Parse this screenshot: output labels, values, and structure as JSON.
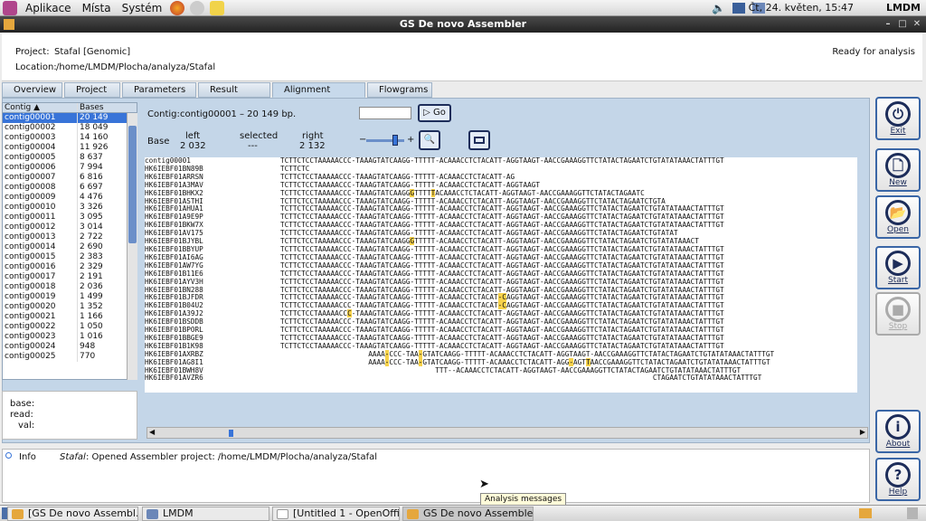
{
  "top_panel": {
    "menus": [
      "Aplikace",
      "Místa",
      "Systém"
    ],
    "clock": "Čt, 24. květen, 15:47",
    "user": "LMDM"
  },
  "window": {
    "title": "GS De novo Assembler"
  },
  "header": {
    "project_label": "Project:",
    "project_value": "Stafal  [Genomic]",
    "location_label": "Location:",
    "location_value": "/home/LMDM/Plocha/analyza/Stafal",
    "status": "Ready for analysis"
  },
  "tabs": [
    "Overview",
    "Project",
    "Parameters",
    "Result files",
    "Alignment results",
    "Flowgrams"
  ],
  "contig_table": {
    "headers": [
      "Contig ▲",
      "Bases"
    ],
    "rows": [
      [
        "contig00001",
        "20 149"
      ],
      [
        "contig00002",
        "18 049"
      ],
      [
        "contig00003",
        "14 160"
      ],
      [
        "contig00004",
        "11 926"
      ],
      [
        "contig00005",
        "8 637"
      ],
      [
        "contig00006",
        "7 994"
      ],
      [
        "contig00007",
        "6 816"
      ],
      [
        "contig00008",
        "6 697"
      ],
      [
        "contig00009",
        "4 476"
      ],
      [
        "contig00010",
        "3 326"
      ],
      [
        "contig00011",
        "3 095"
      ],
      [
        "contig00012",
        "3 014"
      ],
      [
        "contig00013",
        "2 722"
      ],
      [
        "contig00014",
        "2 690"
      ],
      [
        "contig00015",
        "2 383"
      ],
      [
        "contig00016",
        "2 329"
      ],
      [
        "contig00017",
        "2 191"
      ],
      [
        "contig00018",
        "2 036"
      ],
      [
        "contig00019",
        "1 499"
      ],
      [
        "contig00020",
        "1 352"
      ],
      [
        "contig00021",
        "1 166"
      ],
      [
        "contig00022",
        "1 050"
      ],
      [
        "contig00023",
        "1 016"
      ],
      [
        "contig00024",
        "948"
      ],
      [
        "contig00025",
        "770"
      ]
    ]
  },
  "info_panel": {
    "base": "base:",
    "read": "read:",
    "val": "val:"
  },
  "contig_info": {
    "label": "Contig:",
    "value": "contig00001 – 20 149 bp."
  },
  "go_button": "Go",
  "base_info": {
    "label": "Base",
    "left_label": "left",
    "left_value": "2 032",
    "selected_label": "selected",
    "selected_value": "---",
    "right_label": "right",
    "right_value": "2 132"
  },
  "zoom": {
    "minus": "−",
    "plus": "+",
    "level": 0.8
  },
  "alignment": [
    {
      "name": "contig00001",
      "seq": "TCTTCTCCTAAAAACCC-TAAAGTATCAAGG-TTTTT-ACAAACCTCTACATT-AGGTAAGT-AACCGAAAGGTTCTATACTAGAATCTGTATATAAACTATTTGT"
    },
    {
      "name": "HK6IEBF01BN89B",
      "seq": "TCTTCTC"
    },
    {
      "name": "HK6IEBF01ARRSN",
      "seq": "TCTTCTCCTAAAAACCC-TAAAGTATCAAGG-TTTTT-ACAAACCTCTACATT-AG"
    },
    {
      "name": "HK6IEBF01A3MAV",
      "seq": "TCTTCTCCTAAAAACCC-TAAAGTATCAAGG-TTTTT-ACAAACCTCTACATT-AGGTAAGT"
    },
    {
      "name": "HK6IEBF01BHKX2",
      "seq": "TCTTCTCCTAAAAACCC-TAAAGTATCAAGG[G]TTTT[T]ACAAACCTCTACATT-AGGTAAGT-AACCGAAAGGTTCTATACTAGAATC"
    },
    {
      "name": "HK6IEBF01ASTHI",
      "seq": "TCTTCTCCTAAAAACCC-TAAAGTATCAAGG-TTTTT-ACAAACCTCTACATT-AGGTAAGT-AACCGAAAGGTTCTATACTAGAATCTGTA"
    },
    {
      "name": "HK6IEBF01AHUA1",
      "seq": "TCTTCTCCTAAAAACCC-TAAAGTATCAAGG-TTTTT-ACAAACCTCTACATT-AGGTAAGT-AACCGAAAGGTTCTATACTAGAATCTGTATATAAACTATTTGT"
    },
    {
      "name": "HK6IEBF01A9E9P",
      "seq": "TCTTCTCCTAAAAACCC-TAAAGTATCAAGG-TTTTT-ACAAACCTCTACATT-AGGTAAGT-AACCGAAAGGTTCTATACTAGAATCTGTATATAAACTATTTGT"
    },
    {
      "name": "HK6IEBF01BKW7X",
      "seq": "TCTTCTCCTAAAAACCC-TAAAGTATCAAGG-TTTTT-ACAAACCTCTACATT-AGGTAAGT-AACCGAAAGGTTCTATACTAGAATCTGTATATAAACTATTTGT"
    },
    {
      "name": "HK6IEBF01AV175",
      "seq": "TCTTCTCCTAAAAACCC-TAAAGTATCAAGG-TTTTT-ACAAACCTCTACATT-AGGTAAGT-AACCGAAAGGTTCTATACTAGAATCTGTATAT"
    },
    {
      "name": "HK6IEBF01BJYBL",
      "seq": "TCTTCTCCTAAAAACCC-TAAAGTATCAAGG[G]TTTTT-ACAAACCTCTACATT-AGGTAAGT-AACCGAAAGGTTCTATACTAGAATCTGTATATAAACT"
    },
    {
      "name": "HK6IEBF01BBYUP",
      "seq": "TCTTCTCCTAAAAACCC-TAAAGTATCAAGG-TTTTT-ACAAACCTCTACATT-AGGTAAGT-AACCGAAAGGTTCTATACTAGAATCTGTATATAAACTATTTGT"
    },
    {
      "name": "HK6IEBF01AI6AG",
      "seq": "TCTTCTCCTAAAAACCC-TAAAGTATCAAGG-TTTTT-ACAAACCTCTACATT-AGGTAAGT-AACCGAAAGGTTCTATACTAGAATCTGTATATAAACTATTTGT"
    },
    {
      "name": "HK6IEBF01AW7YG",
      "seq": "TCTTCTCCTAAAAACCC-TAAAGTATCAAGG-TTTTT-ACAAACCTCTACATT-AGGTAAGT-AACCGAAAGGTTCTATACTAGAATCTGTATATAAACTATTTGT"
    },
    {
      "name": "HK6IEBF01B11E6",
      "seq": "TCTTCTCCTAAAAACCC-TAAAGTATCAAGG-TTTTT-ACAAACCTCTACATT-AGGTAAGT-AACCGAAAGGTTCTATACTAGAATCTGTATATAAACTATTTGT"
    },
    {
      "name": "HK6IEBF01AYV3H",
      "seq": "TCTTCTCCTAAAAACCC-TAAAGTATCAAGG-TTTTT-ACAAACCTCTACATT-AGGTAAGT-AACCGAAAGGTTCTATACTAGAATCTGTATATAAACTATTTGT"
    },
    {
      "name": "HK6IEBF01BN288",
      "seq": "TCTTCTCCTAAAAACCC-TAAAGTATCAAGG-TTTTT-ACAAACCTCTACATT-AGGTAAGT-AACCGAAAGGTTCTATACTAGAATCTGTATATAAACTATTTGT"
    },
    {
      "name": "HK6IEBF01BJFDR",
      "seq": "TCTTCTCCTAAAAACCC-TAAAGTATCAAGG-TTTTT-ACAAACCTCTACAT[-C]AGGTAAGT-AACCGAAAGGTTCTATACTAGAATCTGTATATAAACTATTTGT"
    },
    {
      "name": "HK6IEBF01B04U2",
      "seq": "TCTTCTCCTAAAAACCC-TAAAGTATCAAGG-TTTTT-ACAAACCTCTACAT[-C]AGGTAAGT-AACCGAAAGGTTCTATACTAGAATCTGTATATAAACTATTTGT"
    },
    {
      "name": "HK6IEBF01A39J2",
      "seq": "TCTTCTCCTAAAAACC[C]-TAAAGTATCAAGG-TTTTT-ACAAACCTCTACATT-AGGTAAGT-AACCGAAAGGTTCTATACTAGAATCTGTATATAAACTATTTGT"
    },
    {
      "name": "HK6IEBF01BSDDB",
      "seq": "TCTTCTCCTAAAAACCC-TAAAGTATCAAGG-TTTTT-ACAAACCTCTACATT-AGGTAAGT-AACCGAAAGGTTCTATACTAGAATCTGTATATAAACTATTTGT"
    },
    {
      "name": "HK6IEBF01BPORL",
      "seq": "TCTTCTCCTAAAAACCC-TAAAGTATCAAGG-TTTTT-ACAAACCTCTACATT-AGGTAAGT-AACCGAAAGGTTCTATACTAGAATCTGTATATAAACTATTTGT"
    },
    {
      "name": "HK6IEBF01BBGE9",
      "seq": "TCTTCTCCTAAAAACCC-TAAAGTATCAAGG-TTTTT-ACAAACCTCTACATT-AGGTAAGT-AACCGAAAGGTTCTATACTAGAATCTGTATATAAACTATTTGT"
    },
    {
      "name": "HK6IEBF01B1K98",
      "seq": "TCTTCTCCTAAAAACCC-TAAAGTATCAAGG-TTTTT-ACAAACCTCTACATT-AGGTAAGT-AACCGAAAGGTTCTATACTAGAATCTGTATATAAACTATTTGT"
    },
    {
      "name": "HK6IEBF01AXRBZ",
      "seq": "                     AAAA[-]CCC-TAA[-]GTATCAAGG-TTTTT-ACAAACCTCTACATT-AGGTAAGT-AACCGAAAGGTTCTATACTAGAATCTGTATATAAACTATTTGT"
    },
    {
      "name": "HK6IEBF01AG8I1",
      "seq": "                     AAAA[-]CCC-TAA[-]GTATCAAGG-TTTTT-ACAAACCTCTACATT-AGG[-]AGT[T]AACCGAAAGGTTCTATACTAGAATCTGTATATAAACTATTTGT"
    },
    {
      "name": "HK6IEBF01BWH8V",
      "seq": "                                     TTT--ACAAACCTCTACATT-AGGTAAGT-AACCGAAAGGTTCTATACTAGAATCTGTATATAAACTATTTGT"
    },
    {
      "name": "HK6IEBF01AVZR6",
      "seq": "                                                                                         CTAGAATCTGTATATAAACTATTTGT"
    }
  ],
  "right_buttons": [
    {
      "icon": "power-icon",
      "glyph": "⏻",
      "label": "Exit",
      "enabled": true
    },
    {
      "icon": "new-document-icon",
      "glyph": "🗋",
      "label": "New",
      "enabled": true
    },
    {
      "icon": "open-folder-icon",
      "glyph": "📂",
      "label": "Open",
      "enabled": true
    },
    {
      "icon": "start-icon",
      "glyph": "▶",
      "label": "Start",
      "enabled": true
    },
    {
      "icon": "stop-icon",
      "glyph": "■",
      "label": "Stop",
      "enabled": false
    },
    {
      "icon": "info-icon",
      "glyph": "i",
      "label": "About",
      "enabled": true
    },
    {
      "icon": "help-icon",
      "glyph": "?",
      "label": "Help",
      "enabled": true
    }
  ],
  "message": {
    "type": "Info",
    "project": "Stafal",
    "text": ": Opened Assembler project: /home/LMDM/Plocha/analyza/Stafal"
  },
  "tooltip": "Analysis messages",
  "taskbar": [
    {
      "label": "[GS De novo Assembl...",
      "active": false
    },
    {
      "label": "LMDM",
      "active": false
    },
    {
      "label": "[Untitled 1 - OpenOffi...",
      "active": false
    },
    {
      "label": "GS De novo Assembler",
      "active": true
    }
  ],
  "colors": {
    "selection": "#3874d8",
    "highlight": "#f7d24a",
    "button_border": "#3a66a6"
  }
}
